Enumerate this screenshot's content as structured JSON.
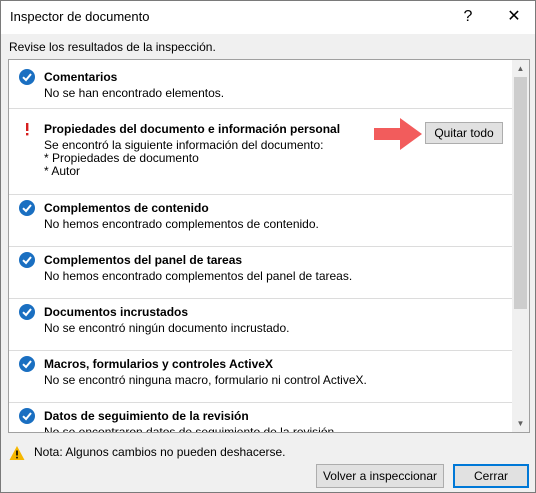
{
  "window": {
    "title": "Inspector de documento",
    "help_glyph": "?",
    "close_glyph": "✕"
  },
  "subtitle": "Revise los resultados de la inspección.",
  "items": [
    {
      "status": "ok",
      "title": "Comentarios",
      "desc": "No se han encontrado elementos."
    },
    {
      "status": "warning",
      "title": "Propiedades del documento e información personal",
      "desc": "Se encontró la siguiente información del documento:",
      "details": [
        "* Propiedades de documento",
        "* Autor"
      ]
    },
    {
      "status": "ok",
      "title": "Complementos de contenido",
      "desc": "No hemos encontrado complementos de contenido."
    },
    {
      "status": "ok",
      "title": "Complementos del panel de tareas",
      "desc": "No hemos encontrado complementos del panel de tareas."
    },
    {
      "status": "ok",
      "title": "Documentos incrustados",
      "desc": "No se encontró ningún documento incrustado."
    },
    {
      "status": "ok",
      "title": "Macros, formularios y controles ActiveX",
      "desc": "No se encontró ninguna macro, formulario ni control ActiveX."
    },
    {
      "status": "ok",
      "title": "Datos de seguimiento de la revisión",
      "desc": "No se encontraron datos de seguimiento de la revisión."
    }
  ],
  "remove_all_label": "Quitar todo",
  "note": "Nota: Algunos cambios no pueden deshacerse.",
  "buttons": {
    "reinspect": "Volver a inspeccionar",
    "close": "Cerrar"
  },
  "colors": {
    "check": "#1a6fc1",
    "warning": "#d61e1e",
    "arrow": "#f25c5c",
    "note_icon": "#f5b700"
  },
  "icons": {
    "ok": "check-circle-icon",
    "warning": "exclamation-icon",
    "note": "warning-triangle-icon"
  }
}
